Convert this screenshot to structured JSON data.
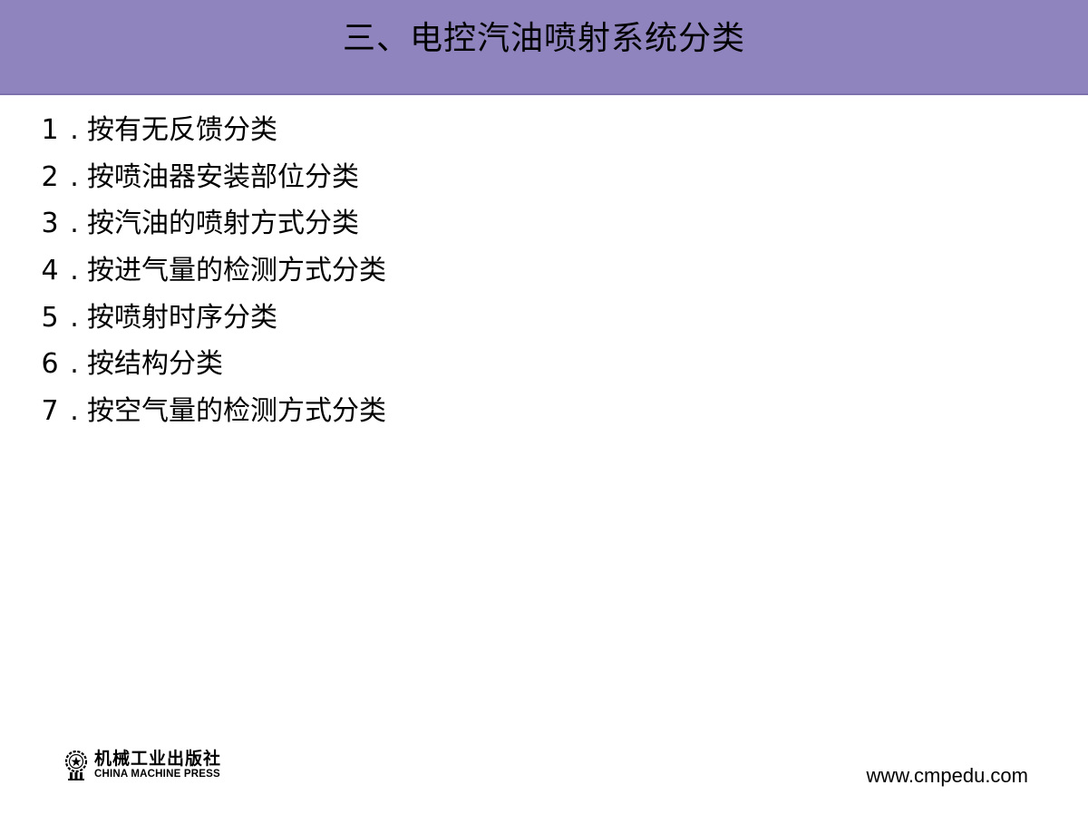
{
  "slide": {
    "title": "三、电控汽油喷射系统分类",
    "items": [
      {
        "number": "1",
        "separator": ".",
        "text": "按有无反馈分类"
      },
      {
        "number": "2",
        "separator": ".",
        "text": "按喷油器安装部位分类"
      },
      {
        "number": "3",
        "separator": ".",
        "text": "按汽油的喷射方式分类"
      },
      {
        "number": "4",
        "separator": ".",
        "text": "按进气量的检测方式分类"
      },
      {
        "number": "5",
        "separator": ".",
        "text": "按喷射时序分类"
      },
      {
        "number": "6",
        "separator": ".",
        "text": "按结构分类"
      },
      {
        "number": "7",
        "separator": ".",
        "text": "按空气量的检测方式分类"
      }
    ]
  },
  "footer": {
    "publisher_name_cn": "机械工业出版社",
    "publisher_name_en": "CHINA MACHINE PRESS",
    "logo_icon": "gear-star-emblem-icon",
    "website": "www.cmpedu.com"
  },
  "colors": {
    "title_bar": "#8f84bd",
    "background": "#ffffff",
    "text": "#000000"
  }
}
